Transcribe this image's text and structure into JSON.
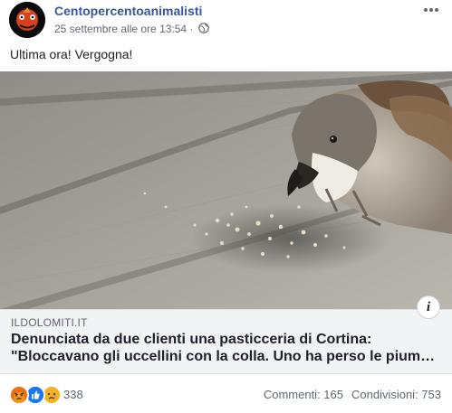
{
  "post": {
    "author": "Centopercentoanimalisti",
    "timestamp": "25 settembre alle ore 13:54",
    "audience_icon": "globe-icon",
    "more_icon": "more-options-icon",
    "message": "Ultima ora! Vergogna!"
  },
  "link_preview": {
    "domain": "ILDOLOMITI.IT",
    "headline": "Denunciata da due clienti una pasticceria di Cortina:\n\"Bloccavano gli uccellini con la colla. Uno ha perso le pium…",
    "info_icon": "i"
  },
  "engagement": {
    "reaction_icons": [
      "angry-reaction-icon",
      "like-reaction-icon",
      "sad-reaction-icon"
    ],
    "reaction_count": "338",
    "comments": "Commenti: 165",
    "shares": "Condivisioni: 753"
  },
  "colors": {
    "author": "#385898",
    "meta": "#606770",
    "link_bg": "#f2f3f5",
    "angry": "#e9710f",
    "like": "#1877f2",
    "sad": "#f7b125"
  }
}
